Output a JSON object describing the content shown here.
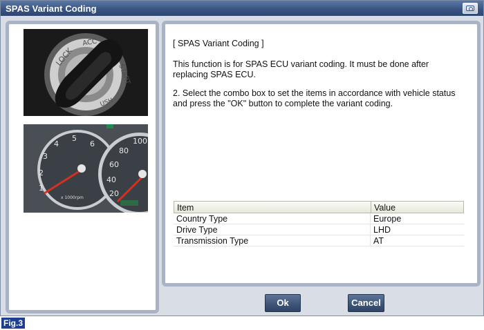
{
  "window": {
    "title": "SPAS Variant Coding",
    "title_button_icon": "camera-icon"
  },
  "left_panel": {
    "photos": [
      "ignition-key-photo",
      "instrument-cluster-photo"
    ]
  },
  "description": {
    "title": "[ SPAS Variant Coding ]",
    "paragraph1": "This function is for SPAS ECU variant coding. It must be done after replacing SPAS ECU.",
    "paragraph2": "2. Select the combo box to set the items in accordance with vehicle status and press the \"OK\" button to complete the variant coding."
  },
  "table": {
    "headers": {
      "item": "Item",
      "value": "Value"
    },
    "rows": [
      {
        "item": "Country Type",
        "value": "Europe"
      },
      {
        "item": "Drive Type",
        "value": "LHD"
      },
      {
        "item": "Transmission Type",
        "value": "AT"
      }
    ]
  },
  "buttons": {
    "ok": "Ok",
    "cancel": "Cancel"
  },
  "figure_label": "Fig.3",
  "colors": {
    "title_bar": "#3a5584",
    "panel_border": "#a9b3c5",
    "button": "#3d5477",
    "figure_label": "#1e3f8f"
  }
}
